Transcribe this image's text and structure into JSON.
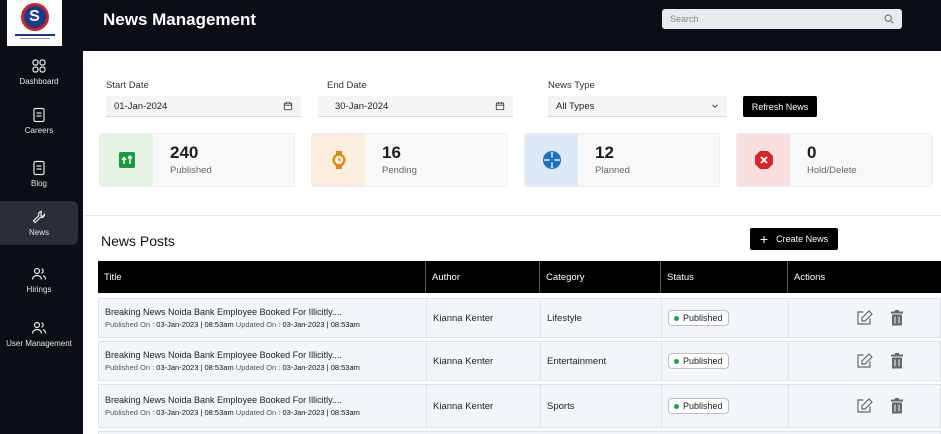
{
  "sidebar": {
    "logo_letter": "S",
    "items": [
      {
        "label": "Dashboard",
        "icon": "dashboard-grid-icon"
      },
      {
        "label": "Careers",
        "icon": "document-icon"
      },
      {
        "label": "Blog",
        "icon": "document-icon"
      },
      {
        "label": "News",
        "icon": "wrench-icon"
      },
      {
        "label": "Hirings",
        "icon": "users-icon"
      },
      {
        "label": "User Management",
        "icon": "users-icon"
      }
    ],
    "active": "News"
  },
  "header": {
    "title": "News Management",
    "search_placeholder": "Search"
  },
  "filters": {
    "start_date_label": "Start Date",
    "start_date_value": "01-Jan-2024",
    "end_date_label": "End Date",
    "end_date_value": "30-Jan-2024",
    "news_type_label": "News Type",
    "news_type_value": "All Types",
    "refresh_label": "Refresh News"
  },
  "stats": [
    {
      "value": "240",
      "label": "Published",
      "icon": "upload-arrows-icon",
      "color": "#1a9a3c",
      "bg": "#e6f4e8"
    },
    {
      "value": "16",
      "label": "Pending",
      "icon": "watch-icon",
      "color": "#d98a1c",
      "bg": "#fbeedd"
    },
    {
      "value": "12",
      "label": "Planned",
      "icon": "crosshair-icon",
      "color": "#1f6fc7",
      "bg": "#dde9f7"
    },
    {
      "value": "0",
      "label": "Hold/Delete",
      "icon": "stop-icon",
      "color": "#d32626",
      "bg": "#f8e0e0"
    }
  ],
  "posts": {
    "section_title": "News Posts",
    "create_label": "Create News",
    "columns": [
      "Title",
      "Author",
      "Category",
      "Status",
      "Actions"
    ],
    "rows": [
      {
        "title": "Breaking News Noida Bank Employee Booked For Illicitly....",
        "published_prefix": "Published On : ",
        "published": "03-Jan-2023 | 08:53am",
        "updated_prefix": " Updated On : ",
        "updated": "03-Jan-2023 | 08:53am",
        "author": "Kianna Kenter",
        "category": "Lifestyle",
        "status": "Published"
      },
      {
        "title": "Breaking News Noida Bank Employee Booked For Illicitly....",
        "published_prefix": "Published On : ",
        "published": "03-Jan-2023 | 08:53am",
        "updated_prefix": " Updated On : ",
        "updated": "03-Jan-2023 | 08:53am",
        "author": "Kianna Kenter",
        "category": "Entertainment",
        "status": "Published"
      },
      {
        "title": "Breaking News Noida Bank Employee Booked For Illicitly....",
        "published_prefix": "Published On : ",
        "published": "03-Jan-2023 | 08:53am",
        "updated_prefix": " Updated On : ",
        "updated": "03-Jan-2023 | 08:53am",
        "author": "Kianna Kenter",
        "category": "Sports",
        "status": "Published"
      }
    ]
  }
}
